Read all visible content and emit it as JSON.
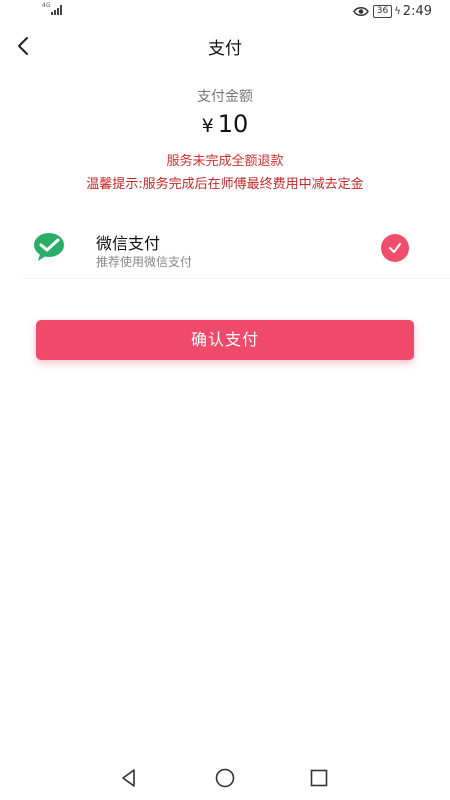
{
  "status_bar": {
    "network": "4G",
    "battery": "36",
    "time": "2:49"
  },
  "nav": {
    "title": "支付"
  },
  "payment": {
    "amount_label": "支付金额",
    "currency": "¥",
    "amount": "10",
    "refund_note": "服务未完成全额退款",
    "tip_note": "温馨提示:服务完成后在师傅最终费用中减去定金"
  },
  "method": {
    "name": "微信支付",
    "desc": "推荐使用微信支付",
    "selected": true
  },
  "confirm_button": {
    "label": "确认支付"
  },
  "colors": {
    "accent": "#f04a6b",
    "warning_text": "#d32f2f",
    "wechat_green": "#2aae67"
  },
  "icons": {
    "back": "back-arrow-icon",
    "wechat": "wechat-icon",
    "check": "check-icon",
    "eye": "eye-icon",
    "nav_back": "nav-back-triangle-icon",
    "nav_home": "nav-home-circle-icon",
    "nav_recent": "nav-recent-square-icon"
  }
}
